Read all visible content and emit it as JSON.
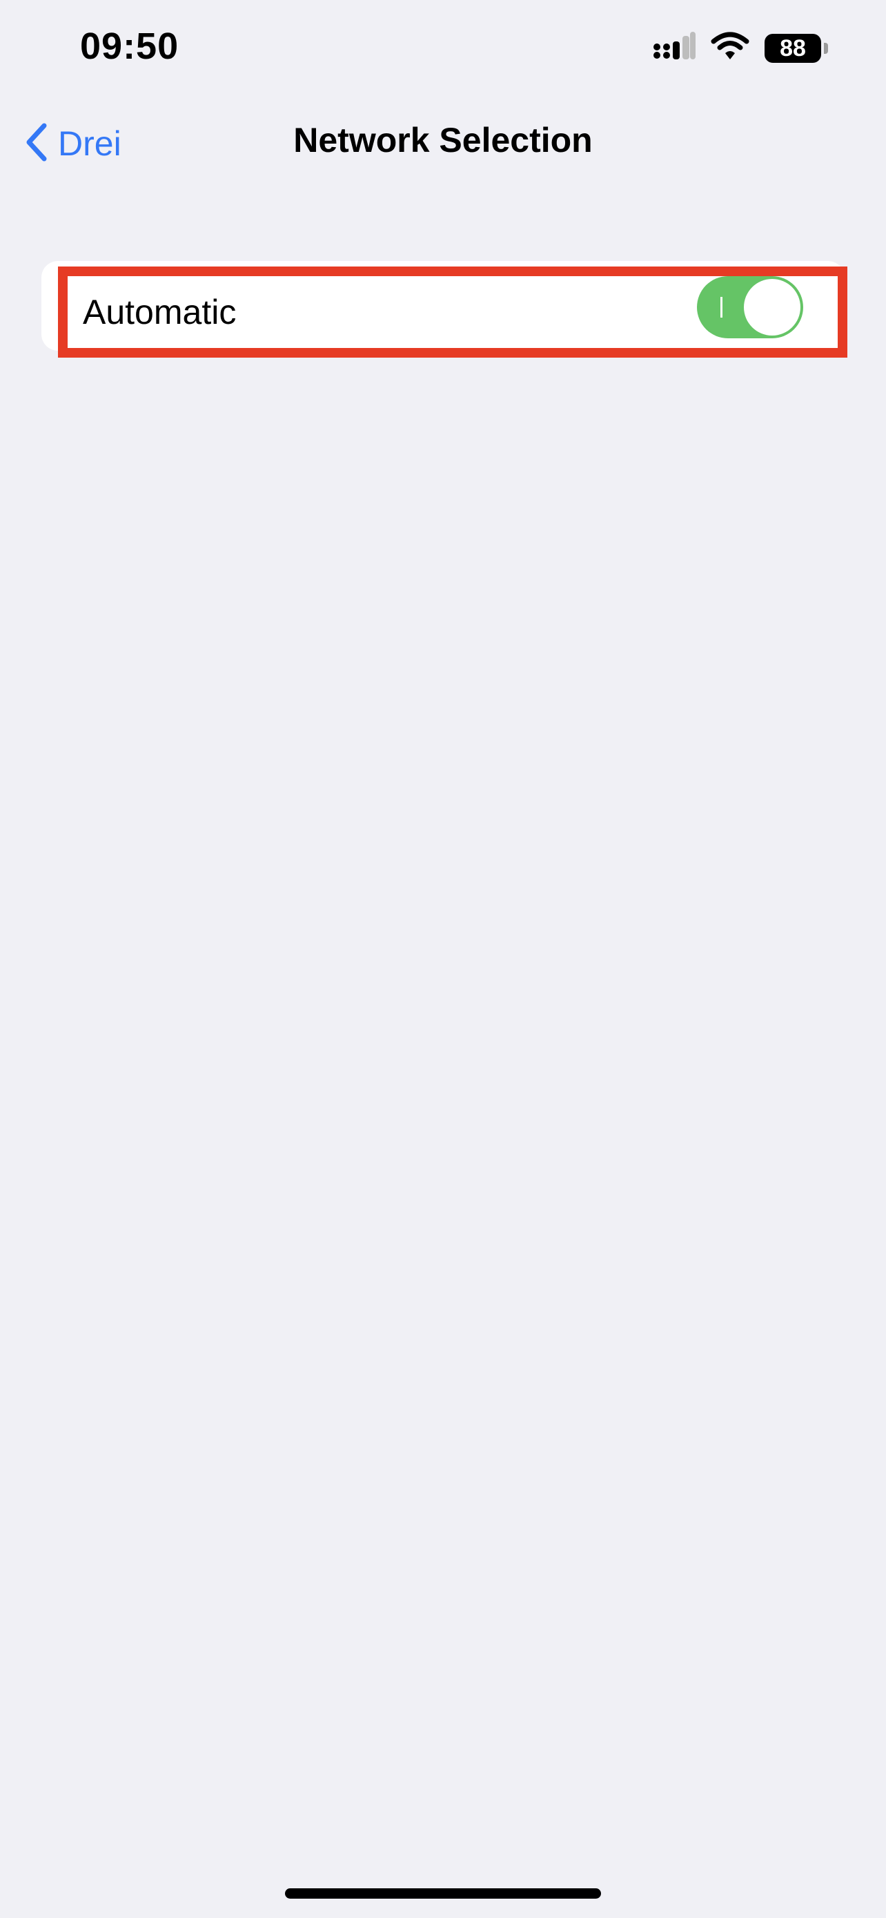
{
  "status_bar": {
    "time": "09:50",
    "battery": "88",
    "icons": [
      "cellular-signal-icon",
      "wifi-icon",
      "battery-icon"
    ]
  },
  "nav": {
    "back_label": "Drei",
    "title": "Network Selection",
    "back_icon": "chevron-left-icon"
  },
  "settings": {
    "automatic": {
      "label": "Automatic",
      "enabled": true
    }
  },
  "colors": {
    "accent": "#3478f6",
    "toggle_on": "#65c466",
    "highlight": "#e63b24",
    "background": "#f0f0f5"
  }
}
